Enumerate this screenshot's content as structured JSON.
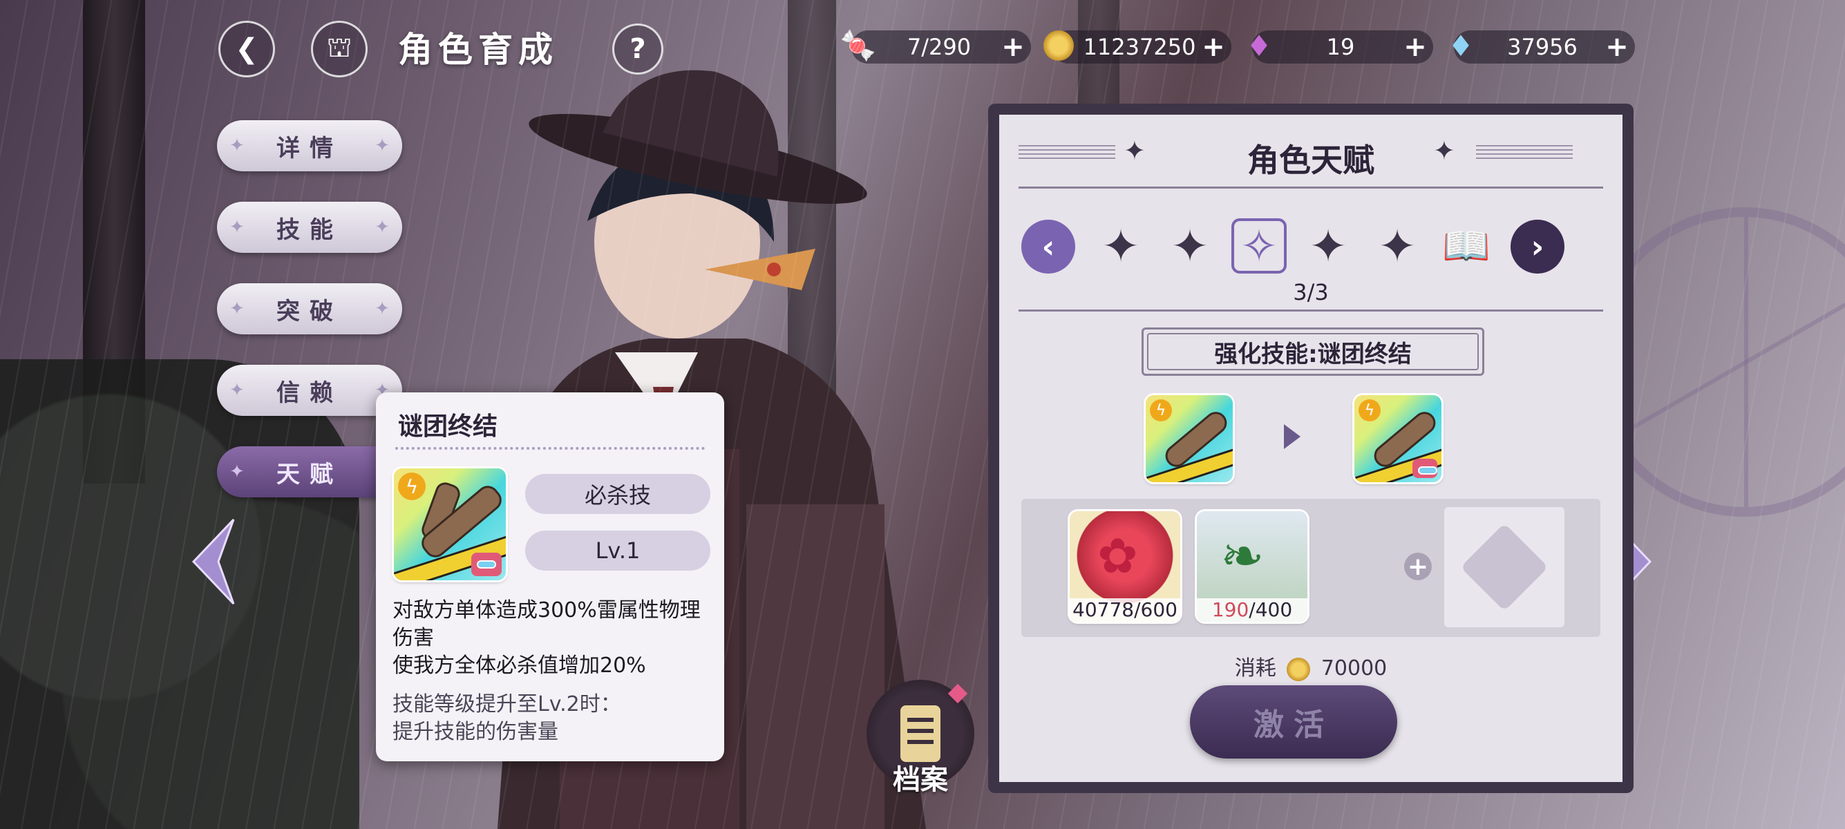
{
  "header": {
    "title": "角色育成",
    "back_icon": "back-arrow-icon",
    "home_icon": "castle-icon",
    "help_label": "?"
  },
  "resources": [
    {
      "name": "stamina",
      "icon": "candy-icon",
      "value": "7/290"
    },
    {
      "name": "coins",
      "icon": "coin-icon",
      "value": "11237250"
    },
    {
      "name": "gems-purple",
      "icon": "purple-gem-icon",
      "value": "19"
    },
    {
      "name": "gems-blue",
      "icon": "blue-diamond-icon",
      "value": "37956"
    }
  ],
  "menu": {
    "items": [
      {
        "label": "详情",
        "active": false
      },
      {
        "label": "技能",
        "active": false
      },
      {
        "label": "突破",
        "active": false
      },
      {
        "label": "信赖",
        "active": false
      },
      {
        "label": "天赋",
        "active": true
      }
    ]
  },
  "tooltip": {
    "title": "谜团终结",
    "type_label": "必杀技",
    "level_label": "Lv.1",
    "desc_line1": "对敌方单体造成300%雷属性物理伤害",
    "desc_line2": "使我方全体必杀值增加20%",
    "next_line1": "技能等级提升至Lv.2时：",
    "next_line2": "提升技能的伤害量"
  },
  "panel": {
    "title": "角色天赋",
    "counter": "3/3",
    "enhance_label": "强化技能:谜团终结",
    "materials": [
      {
        "icon": "red-flower-icon",
        "owned": "40778",
        "need": "/600",
        "lacking": false
      },
      {
        "icon": "green-leaf-icon",
        "owned": "190",
        "need": "/400",
        "lacking": true
      }
    ],
    "cost_label": "消耗",
    "cost_value": "70000",
    "activate_label": "激活"
  },
  "archive": {
    "label": "档案"
  },
  "colors": {
    "accent": "#6a5a8c",
    "panel_bg": "#e6e3ea",
    "lack": "#d04a5a"
  }
}
